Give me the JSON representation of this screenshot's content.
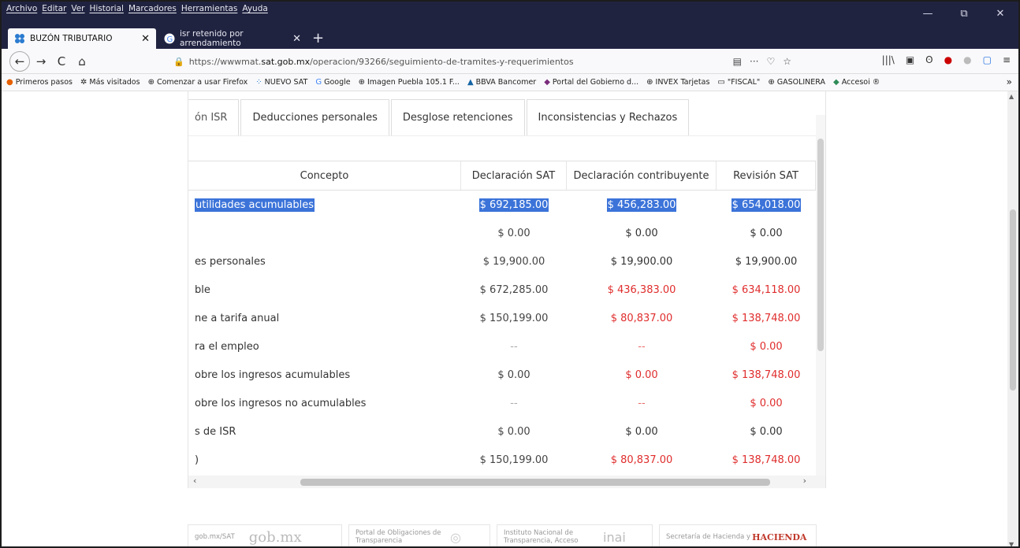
{
  "menu": [
    "Archivo",
    "Editar",
    "Ver",
    "Historial",
    "Marcadores",
    "Herramientas",
    "Ayuda"
  ],
  "window_controls": {
    "minimize": "—",
    "restore": "⧉",
    "close": "✕"
  },
  "tabs": [
    {
      "title": "BUZÓN TRIBUTARIO",
      "close": "✕"
    },
    {
      "title": "isr retenido por arrendamiento",
      "close": "✕"
    }
  ],
  "new_tab": "+",
  "nav": {
    "back": "←",
    "forward": "→",
    "reload": "C",
    "home": "⌂",
    "url_prefix": "https://wwwmat.",
    "url_domain": "sat.gob.mx",
    "url_path": "/operacion/93266/seguimiento-de-tramites-y-requerimientos",
    "url_actions": [
      "▤",
      "···",
      "♡",
      "☆"
    ]
  },
  "extensions": [
    "|||\\",
    "▣",
    "ʘ",
    "●",
    "●",
    "▢",
    "≡"
  ],
  "bookmarks": [
    "Primeros pasos",
    "Más visitados",
    "Comenzar a usar Firefox",
    "NUEVO SAT",
    "Google",
    "Imagen Puebla 105.1 F...",
    "BBVA Bancomer",
    "Portal del Gobierno d...",
    "INVEX Tarjetas",
    "\"FISCAL\"",
    "GASOLINERA",
    "Accesoi ®"
  ],
  "bookmarks_more": "»",
  "section_tabs": [
    "ón ISR",
    "Deducciones personales",
    "Desglose retenciones",
    "Inconsistencias y Rechazos"
  ],
  "table": {
    "headers": [
      "Concepto",
      "Declaración SAT",
      "Declaración contribuyente",
      "Revisión SAT"
    ],
    "rows": [
      {
        "concepto": "utilidades acumulables",
        "sat": "$ 692,185.00",
        "contrib": "$ 456,283.00",
        "rev": "$ 654,018.00"
      },
      {
        "concepto": "",
        "sat": "$ 0.00",
        "contrib": "$ 0.00",
        "rev": "$ 0.00"
      },
      {
        "concepto": "es personales",
        "sat": "$ 19,900.00",
        "contrib": "$ 19,900.00",
        "rev": "$ 19,900.00"
      },
      {
        "concepto": "ble",
        "sat": "$ 672,285.00",
        "contrib": "$ 436,383.00",
        "rev": "$ 634,118.00"
      },
      {
        "concepto": "ne a tarifa anual",
        "sat": "$ 150,199.00",
        "contrib": "$ 80,837.00",
        "rev": "$ 138,748.00"
      },
      {
        "concepto": "ra el empleo",
        "sat": "--",
        "contrib": "--",
        "rev": "$ 0.00"
      },
      {
        "concepto": "obre los ingresos acumulables",
        "sat": "$ 0.00",
        "contrib": "$ 0.00",
        "rev": "$ 138,748.00"
      },
      {
        "concepto": "obre los ingresos no acumulables",
        "sat": "--",
        "contrib": "--",
        "rev": "$ 0.00"
      },
      {
        "concepto": "s de ISR",
        "sat": "$ 0.00",
        "contrib": "$ 0.00",
        "rev": "$ 0.00"
      },
      {
        "concepto": ")",
        "sat": "$ 150,199.00",
        "contrib": "$ 80,837.00",
        "rev": "$ 138,748.00"
      }
    ]
  },
  "footer": {
    "box1_small": "gob.mx/SAT",
    "box1_big": "gob.mx",
    "box2": "Portal de Obligaciones de Transparencia",
    "box3": "Instituto Nacional de Transparencia, Acceso",
    "box4_small": "Secretaría de Hacienda y",
    "box4_big": "HACIENDA"
  }
}
